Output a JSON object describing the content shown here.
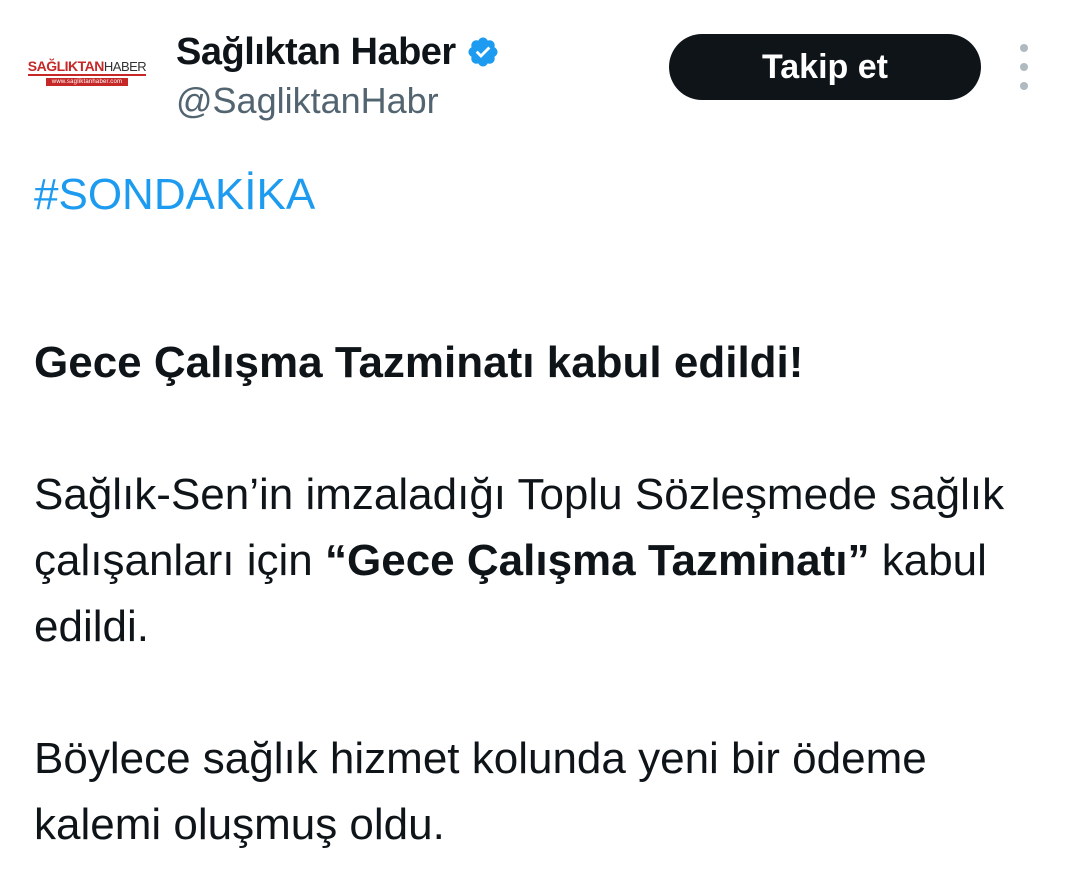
{
  "account": {
    "display_name": "Sağlıktan Haber",
    "handle": "@SagliktanHabr",
    "logo_text_1": "SAĞLIKTAN",
    "logo_text_2": "HABER",
    "logo_subtext": "www.sagliktanhaber.com",
    "verified_icon": "verified-badge-icon"
  },
  "follow_button_label": "Takip et",
  "more_icon": "more-vertical-icon",
  "tweet": {
    "hashtag": "#SONDAKİKA",
    "headline": "Gece Çalışma Tazminatı kabul edildi!",
    "para1_text1": "Sağlık-Sen’in imzaladığı Toplu Sözleşmede sağlık çalışanları için ",
    "para1_bold": "“Gece Çalışma Tazminatı”",
    "para1_text2": " kabul edildi.",
    "para2": "Böylece sağlık hizmet kolunda yeni bir ödeme kalemi oluşmuş oldu."
  },
  "colors": {
    "link_blue": "#1d9bf0",
    "text_primary": "#0f1419",
    "text_secondary": "#536471",
    "button_bg": "#0f1419",
    "logo_red": "#c62828"
  }
}
